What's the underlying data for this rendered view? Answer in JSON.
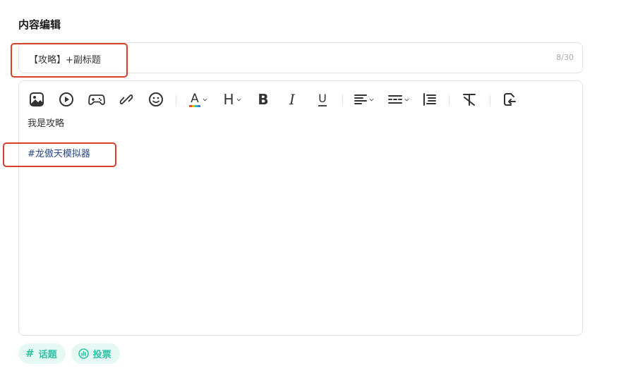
{
  "section": {
    "title": "内容编辑"
  },
  "title_input": {
    "value": "【攻略】+副标题",
    "counter": "8/30"
  },
  "editor": {
    "toolbar": [
      {
        "name": "image-icon"
      },
      {
        "name": "video-icon"
      },
      {
        "name": "game-icon"
      },
      {
        "name": "link-icon"
      },
      {
        "name": "emoji-icon"
      },
      {
        "name": "font-color-icon"
      },
      {
        "name": "heading-icon"
      },
      {
        "name": "bold-icon"
      },
      {
        "name": "italic-icon"
      },
      {
        "name": "underline-icon"
      },
      {
        "name": "align-icon"
      },
      {
        "name": "list-icon"
      },
      {
        "name": "line-height-icon"
      },
      {
        "name": "clear-format-icon"
      },
      {
        "name": "redo-icon"
      }
    ],
    "heading_glyph": "H",
    "bold_glyph": "B",
    "italic_glyph": "I",
    "underline_glyph": "U",
    "font_color_glyph": "A",
    "lines": [
      "我是攻略",
      "",
      "#龙傲天模拟器"
    ]
  },
  "chips": {
    "topic": {
      "icon": "#",
      "label": "话题"
    },
    "vote": {
      "icon": "vote-icon",
      "label": "投票"
    }
  },
  "colors": {
    "accent": "#2fc2a5",
    "chip_bg": "#e6f8f4",
    "highlight": "#d8402c",
    "hashtag": "#2b4a8a"
  }
}
